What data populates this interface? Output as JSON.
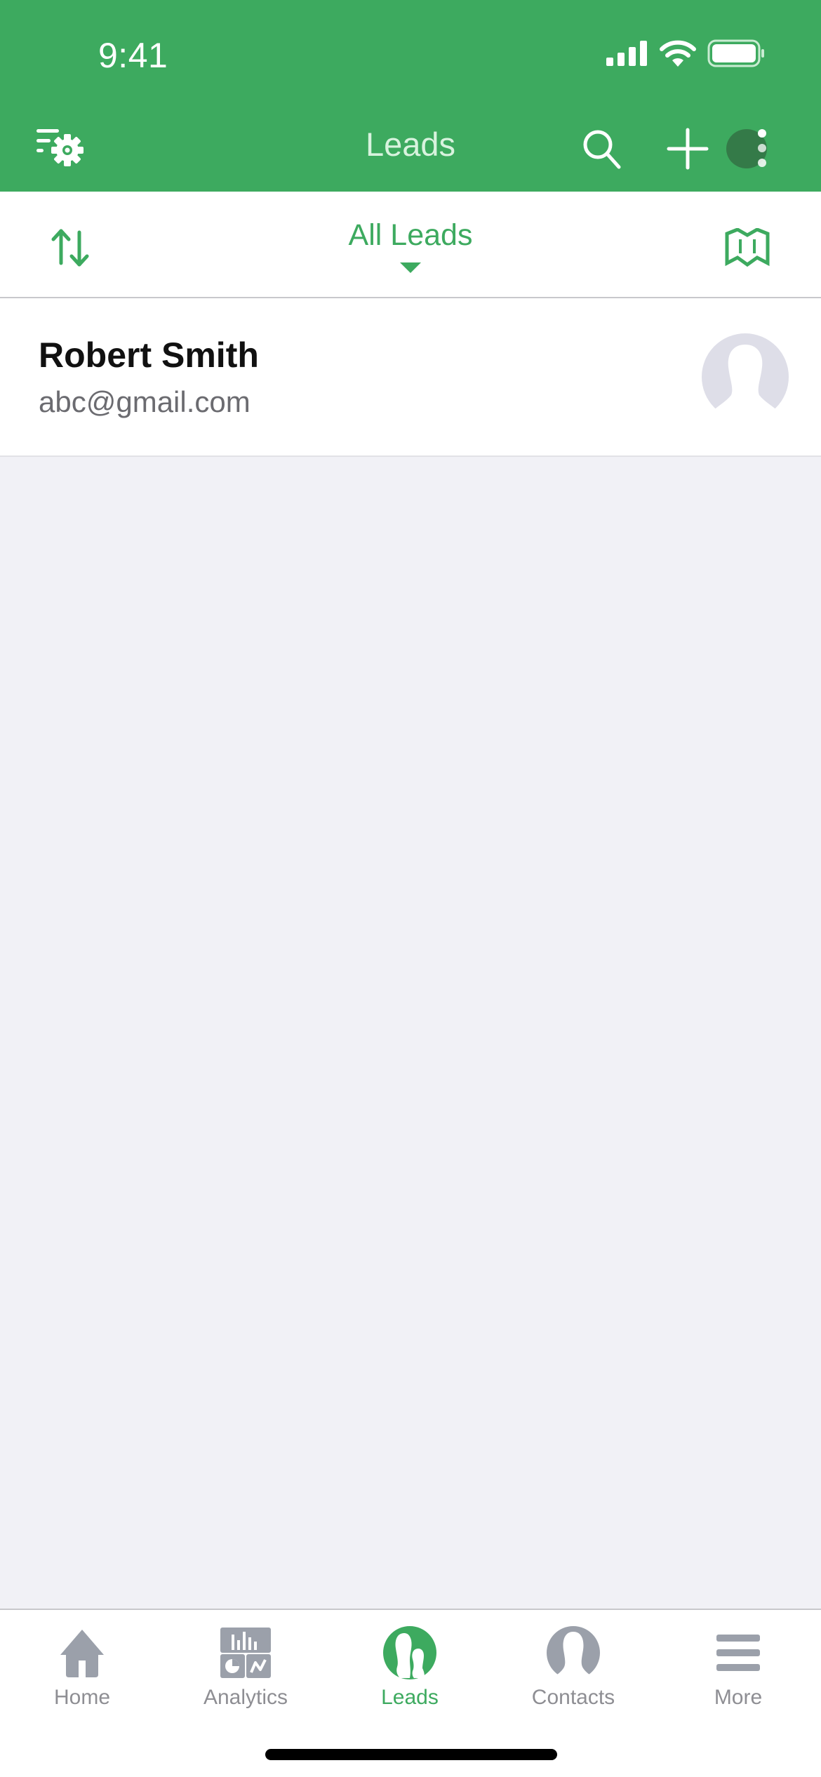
{
  "status_bar": {
    "time": "9:41"
  },
  "header": {
    "title": "Leads",
    "icons": {
      "filter_settings": "filter-settings-icon",
      "search": "search-icon",
      "add": "plus-icon",
      "more": "more-vertical-icon"
    }
  },
  "filter_bar": {
    "view_label": "All Leads",
    "sort_icon": "sort-arrows-icon",
    "map_icon": "map-icon"
  },
  "leads": [
    {
      "name": "Robert Smith",
      "email": "abc@gmail.com"
    }
  ],
  "tabbar": {
    "items": [
      {
        "label": "Home",
        "icon": "home-icon",
        "active": false
      },
      {
        "label": "Analytics",
        "icon": "analytics-icon",
        "active": false
      },
      {
        "label": "Leads",
        "icon": "leads-icon",
        "active": true
      },
      {
        "label": "Contacts",
        "icon": "contacts-icon",
        "active": false
      },
      {
        "label": "More",
        "icon": "hamburger-icon",
        "active": false
      }
    ]
  },
  "colors": {
    "brand_green": "#3daa5f",
    "header_title": "#d8f3de",
    "inactive_tab": "#8e8e93",
    "background": "#f1f1f6"
  }
}
